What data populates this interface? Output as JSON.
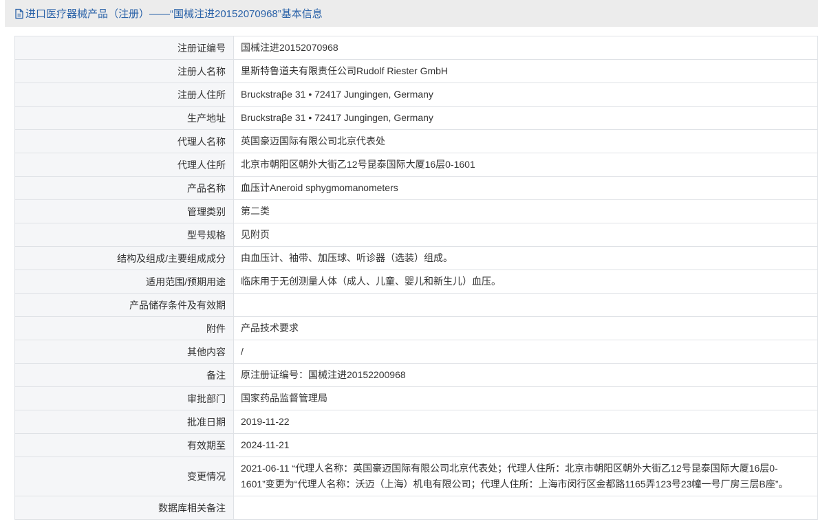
{
  "header": {
    "title": "进口医疗器械产品（注册）——“国械注进20152070968”基本信息"
  },
  "rows": [
    {
      "label": "注册证编号",
      "value": "国械注进20152070968"
    },
    {
      "label": "注册人名称",
      "value": "里斯特鲁道夫有限责任公司Rudolf Riester GmbH"
    },
    {
      "label": "注册人住所",
      "value": "Bruckstraβe 31 • 72417 Jungingen, Germany"
    },
    {
      "label": "生产地址",
      "value": "Bruckstraβe 31 • 72417 Jungingen, Germany"
    },
    {
      "label": "代理人名称",
      "value": "英国豪迈国际有限公司北京代表处"
    },
    {
      "label": "代理人住所",
      "value": "北京市朝阳区朝外大街乙12号昆泰国际大厦16层0-1601"
    },
    {
      "label": "产品名称",
      "value": "血压计Aneroid sphygmomanometers"
    },
    {
      "label": "管理类别",
      "value": "第二类"
    },
    {
      "label": "型号规格",
      "value": "见附页"
    },
    {
      "label": "结构及组成/主要组成成分",
      "value": "由血压计、袖带、加压球、听诊器（选装）组成。"
    },
    {
      "label": "适用范围/预期用途",
      "value": "临床用于无创测量人体（成人、儿童、婴儿和新生儿）血压。"
    },
    {
      "label": "产品储存条件及有效期",
      "value": ""
    },
    {
      "label": "附件",
      "value": "产品技术要求"
    },
    {
      "label": "其他内容",
      "value": "/"
    },
    {
      "label": "备注",
      "value": "原注册证编号：国械注进20152200968"
    },
    {
      "label": "审批部门",
      "value": "国家药品监督管理局"
    },
    {
      "label": "批准日期",
      "value": "2019-11-22"
    },
    {
      "label": "有效期至",
      "value": "2024-11-21"
    },
    {
      "label": "变更情况",
      "value": "2021-06-11 “代理人名称：英国豪迈国际有限公司北京代表处；代理人住所：北京市朝阳区朝外大街乙12号昆泰国际大厦16层0-1601”变更为“代理人名称：沃迈（上海）机电有限公司；代理人住所：上海市闵行区金都路1165弄123号23幢一号厂房三层B座”。"
    },
    {
      "label": "数据库相关备注",
      "value": ""
    }
  ]
}
